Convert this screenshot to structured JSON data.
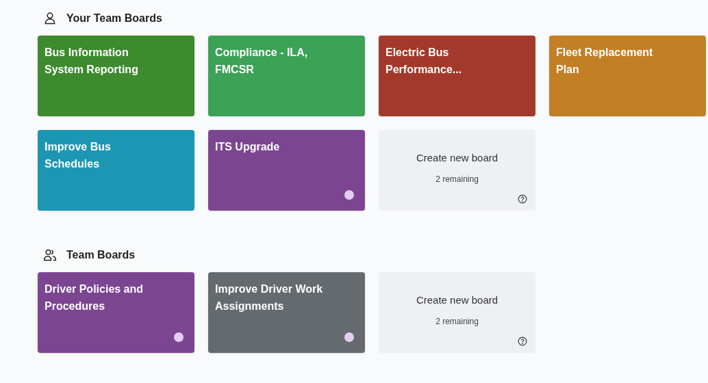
{
  "sections": [
    {
      "title": "Your Team Boards",
      "kind": "personal",
      "boards": [
        {
          "kind": "board",
          "title": "Bus Information System Reporting",
          "color": "#3d8a2f",
          "dot": false
        },
        {
          "kind": "board",
          "title": "Compliance - ILA, FMCSR",
          "color": "#3ba257",
          "dot": false
        },
        {
          "kind": "board",
          "title": "Electric Bus Performance...",
          "color": "#a3392a",
          "dot": false
        },
        {
          "kind": "board",
          "title": "Fleet Replacement Plan",
          "color": "#c27f24",
          "dot": false
        },
        {
          "kind": "board",
          "title": "Improve Bus Schedules",
          "color": "#1b97b3",
          "dot": false
        },
        {
          "kind": "board",
          "title": "ITS Upgrade",
          "color": "#7c4592",
          "dot": true
        },
        {
          "kind": "create",
          "title": "Create new board",
          "subtitle": "2 remaining"
        }
      ]
    },
    {
      "title": "Team Boards",
      "kind": "team",
      "boards": [
        {
          "kind": "board",
          "title": "Driver Policies and Procedures",
          "color": "#7c4592",
          "dot": true
        },
        {
          "kind": "board",
          "title": "Improve Driver Work Assignments",
          "color": "#646a6e",
          "dot": true
        },
        {
          "kind": "create",
          "title": "Create new board",
          "subtitle": "2 remaining"
        }
      ]
    }
  ]
}
